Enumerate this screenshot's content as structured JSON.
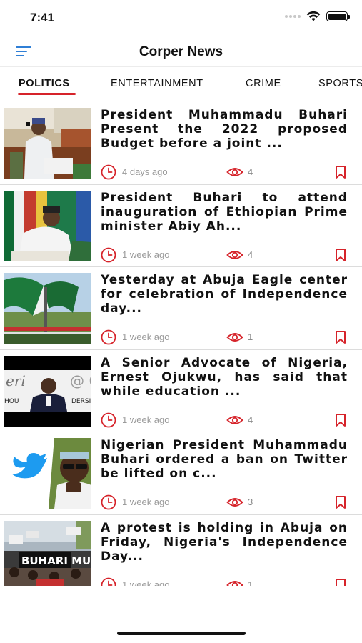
{
  "status_bar": {
    "time": "7:41"
  },
  "app": {
    "title": "Corper News",
    "accent_color": "#d6232a",
    "menu_color": "#2f7fd6"
  },
  "tabs": [
    {
      "label": "POLITICS",
      "active": true
    },
    {
      "label": "ENTERTAINMENT",
      "active": false
    },
    {
      "label": "CRIME",
      "active": false
    },
    {
      "label": "SPORTS",
      "active": false
    }
  ],
  "articles": [
    {
      "headline": "President Muhammadu Buhari Present the 2022 proposed Budget before a joint ...",
      "time": "4 days ago",
      "views": "4",
      "thumbnail": "buhari-budget-photo"
    },
    {
      "headline": "President Buhari to attend inauguration of Ethiopian Prime minister Abiy Ah...",
      "time": "1 week ago",
      "views": "4",
      "thumbnail": "buhari-desk-photo"
    },
    {
      "headline": "Yesterday at Abuja Eagle center for celebration of  Independence day...",
      "time": "1 week ago",
      "views": "1",
      "thumbnail": "independence-parade-photo"
    },
    {
      "headline": "A Senior Advocate of Nigeria, Ernest Ojukwu, has said that while education ...",
      "time": "1 week ago",
      "views": "4",
      "thumbnail": "ernest-ojukwu-photo"
    },
    {
      "headline": "Nigerian President Muhammadu Buhari ordered a ban on Twitter be lifted on c...",
      "time": "1 week ago",
      "views": "3",
      "thumbnail": "twitter-buhari-photo"
    },
    {
      "headline": "A protest is holding in Abuja on Friday, Nigeria's Independence Day...",
      "time": "1 week ago",
      "views": "1",
      "thumbnail": "abuja-protest-photo"
    }
  ]
}
